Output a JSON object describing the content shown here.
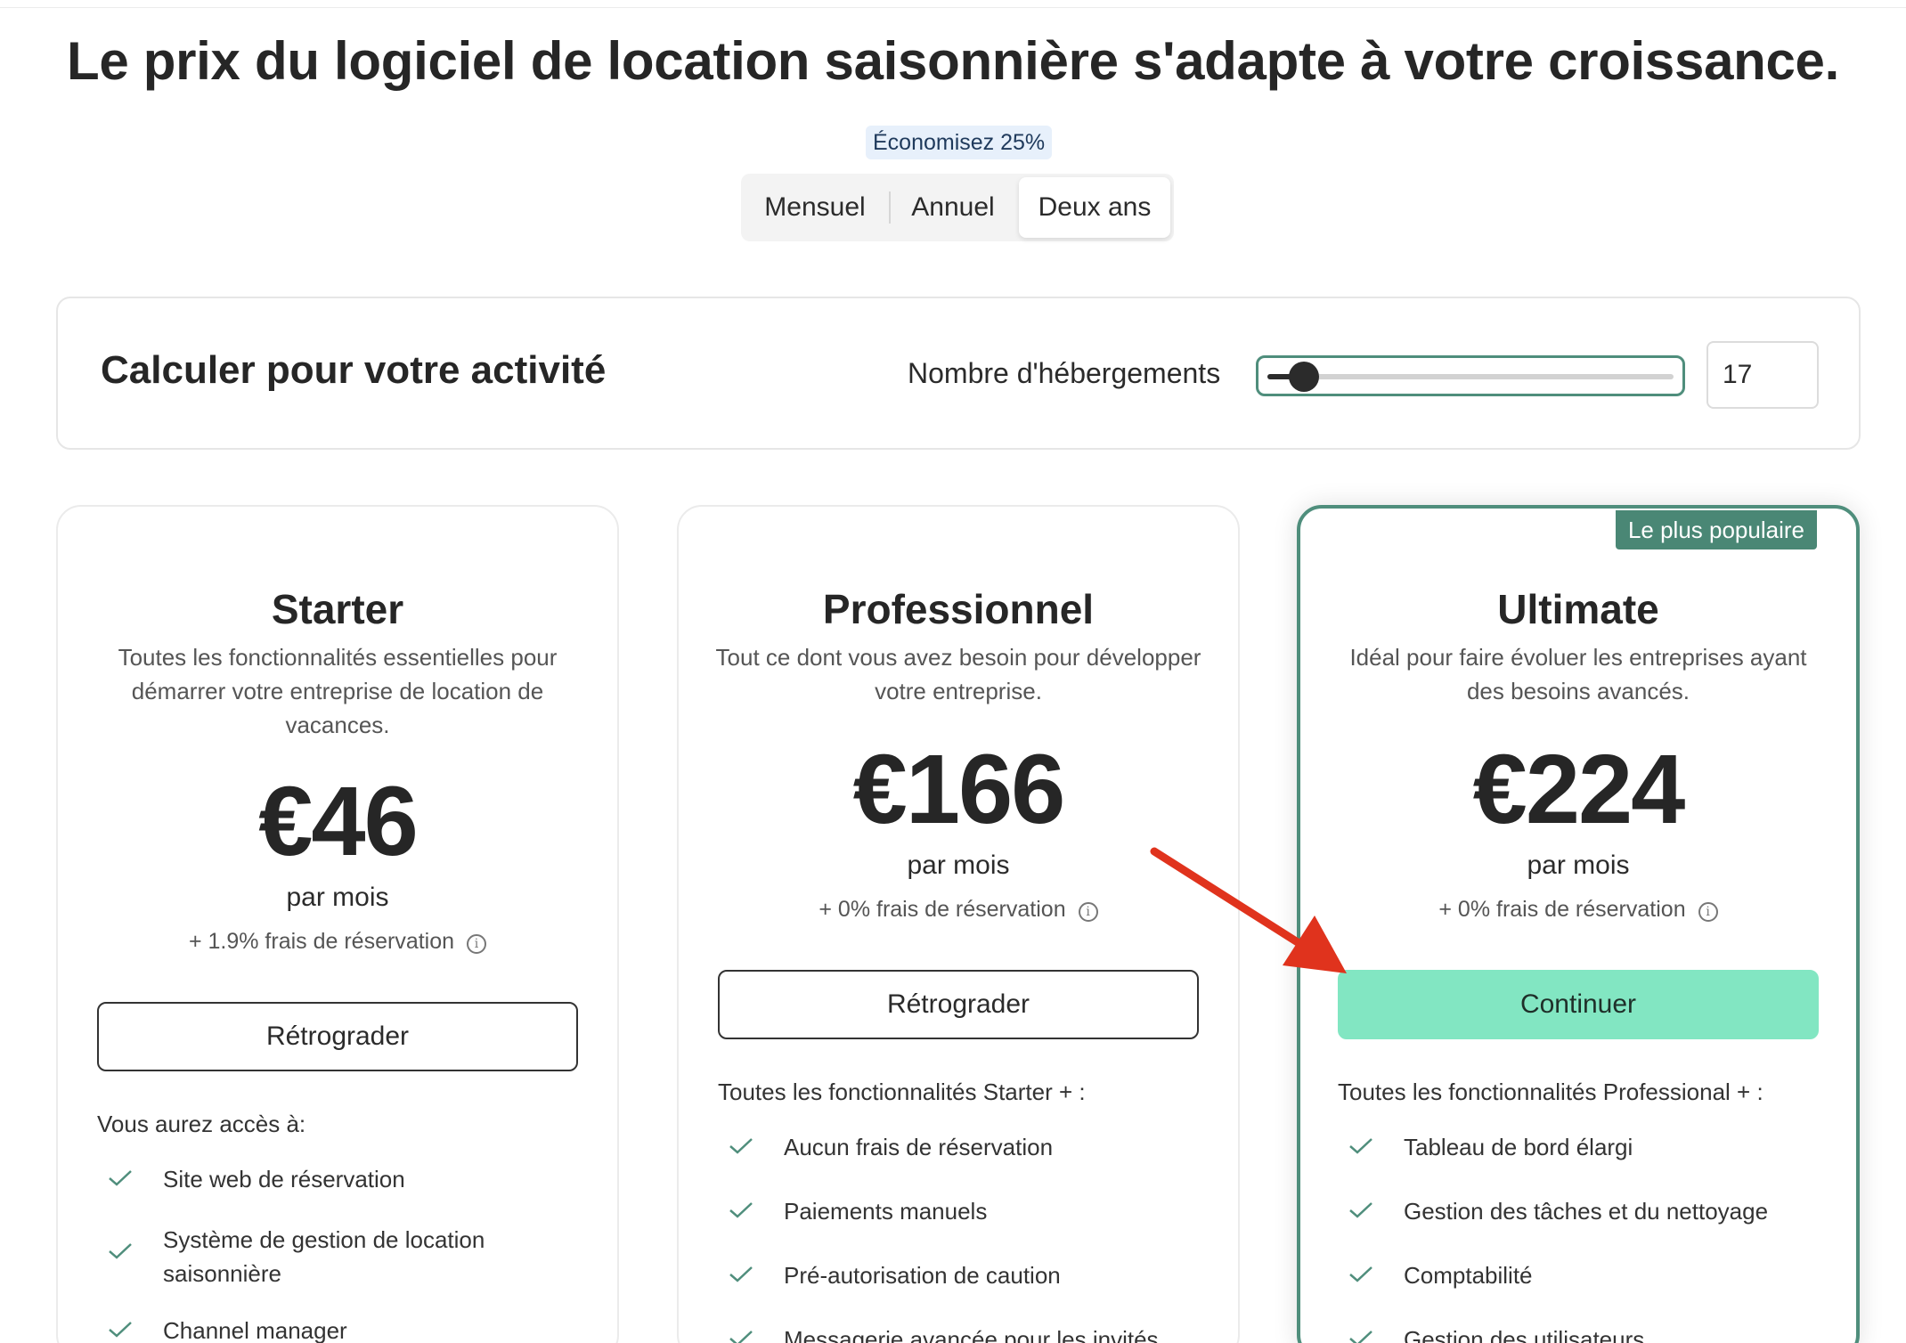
{
  "headline": "Le prix du logiciel de location saisonnière s'adapte à votre croissance.",
  "billing": {
    "save_badge": "Économisez 25%",
    "options": [
      "Mensuel",
      "Annuel",
      "Deux ans"
    ],
    "selected": "Deux ans"
  },
  "calculator": {
    "title": "Calculer pour votre activité",
    "label": "Nombre d'hébergements",
    "value": "17",
    "slider_fraction": 0.06
  },
  "plans": [
    {
      "name": "Starter",
      "description": "Toutes les fonctionnalités essentielles pour démarrer votre entreprise de location de vacances.",
      "price": "€46",
      "period": "par mois",
      "fee": "+ 1.9% frais de réservation",
      "button": "Rétrograder",
      "features_heading": "Vous aurez accès à:",
      "features": [
        "Site web de réservation",
        "Système de gestion de location saisonnière",
        "Channel manager"
      ]
    },
    {
      "name": "Professionnel",
      "description": "Tout ce dont vous avez besoin pour développer votre entreprise.",
      "price": "€166",
      "period": "par mois",
      "fee": "+ 0% frais de réservation",
      "button": "Rétrograder",
      "features_heading": "Toutes les fonctionnalités Starter + :",
      "features": [
        "Aucun frais de réservation",
        "Paiements manuels",
        "Pré-autorisation de caution",
        "Messagerie avancée pour les invités"
      ]
    },
    {
      "name": "Ultimate",
      "badge": "Le plus populaire",
      "description": "Idéal pour faire évoluer les entreprises ayant des besoins avancés.",
      "price": "€224",
      "period": "par mois",
      "fee": "+ 0% frais de réservation",
      "button": "Continuer",
      "features_heading": "Toutes les fonctionnalités Professional + :",
      "features": [
        "Tableau de bord élargi",
        "Gestion des tâches et du nettoyage",
        "Comptabilité",
        "Gestion des utilisateurs"
      ]
    }
  ],
  "colors": {
    "accent_green": "#4f8e7c",
    "primary_button": "#82e6c2",
    "annotation_arrow": "#e0331d"
  },
  "icons": {
    "check": "check-icon",
    "info": "info-icon"
  }
}
